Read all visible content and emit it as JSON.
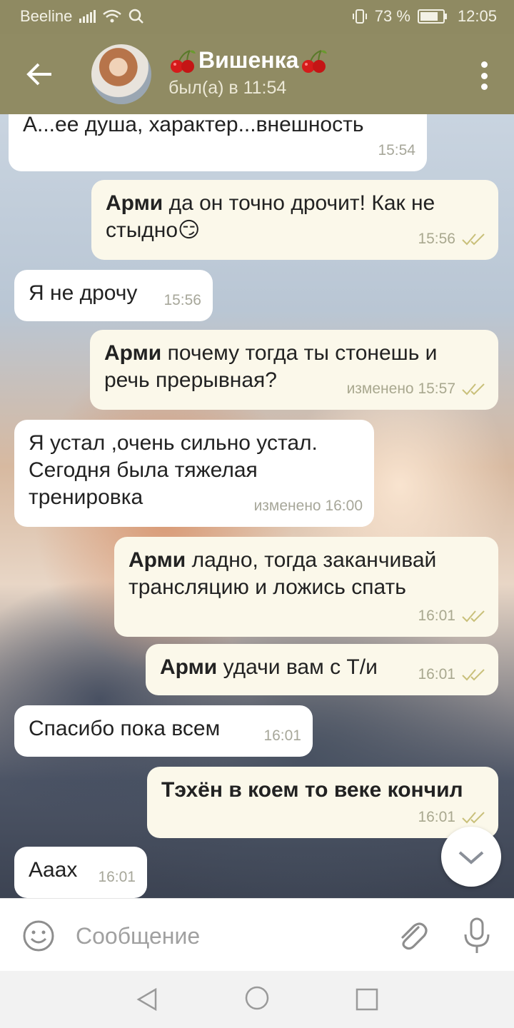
{
  "status_bar": {
    "carrier": "Beeline",
    "battery": "73 %",
    "time": "12:05"
  },
  "header": {
    "title": "Вишенка",
    "status": "был(а) в 11:54"
  },
  "messages": [
    {
      "dir": "in",
      "sender": "",
      "text": "А...ее душа, характер...внешность",
      "time": "15:54"
    },
    {
      "dir": "out",
      "sender": "Арми",
      "text": " да он точно дрочит! Как не стыдно😏",
      "time": "15:56"
    },
    {
      "dir": "in",
      "sender": "",
      "text": "Я не дрочу",
      "time": "15:56"
    },
    {
      "dir": "out",
      "sender": "Арми",
      "text": " почему тогда ты стонешь и речь прерывная?",
      "time": "изменено 15:57"
    },
    {
      "dir": "in",
      "sender": "",
      "text": "Я устал ,очень сильно устал. Сегодня была тяжелая тренировка",
      "time": "изменено 16:00"
    },
    {
      "dir": "out",
      "sender": "Арми",
      "text": " ладно, тогда заканчивай трансляцию и ложись спать",
      "time": "16:01"
    },
    {
      "dir": "out",
      "sender": "Арми",
      "text": " удачи вам с Т/и",
      "time": "16:01"
    },
    {
      "dir": "in",
      "sender": "",
      "text": "Спасибо пока всем",
      "time": "16:01"
    },
    {
      "dir": "out",
      "sender": "",
      "text": "Тэхён в коем то веке кончил",
      "time": "16:01"
    },
    {
      "dir": "in",
      "sender": "",
      "text": "Аaax",
      "time": "16:01"
    }
  ],
  "input": {
    "placeholder": "Сообщение"
  },
  "colors": {
    "header": "#908b63",
    "status_bar": "#8f8a62",
    "bubble_in": "#ffffff",
    "bubble_out": "#fbf8ea",
    "read_tick": "#c9c07a"
  }
}
